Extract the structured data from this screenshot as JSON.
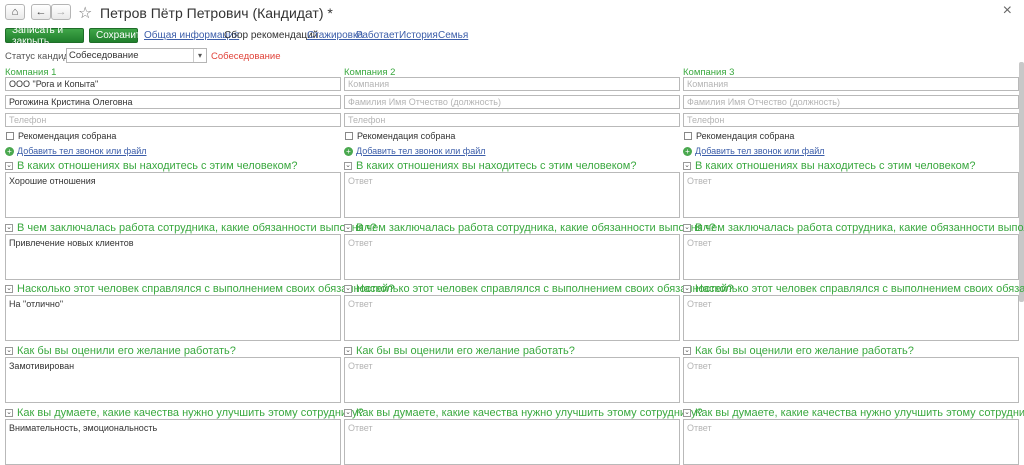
{
  "window": {
    "title": "Петров Пётр Петрович (Кандидат) *",
    "home_icon": "home-icon",
    "back_icon": "arrow-left-icon",
    "forward_icon": "arrow-right-icon",
    "favorite_icon": "star-icon",
    "close_icon": "close-icon"
  },
  "toolbar": {
    "save_close_label": "Записать и закрыть",
    "save_label": "Сохранить",
    "tabs": [
      {
        "label": "Общая информация",
        "active": false
      },
      {
        "label": "Сбор рекомендаций",
        "active": true
      },
      {
        "label": "Стажировка",
        "active": false
      },
      {
        "label": "Работает",
        "active": false
      },
      {
        "label": "История",
        "active": false
      },
      {
        "label": "Семья",
        "active": false
      }
    ]
  },
  "status": {
    "label": "Статус кандидата:",
    "value": "Собеседование",
    "note": "Собеседование"
  },
  "companies": [
    {
      "title": "Компания 1",
      "company_value": "ООО \"Рога и Копыта\"",
      "company_placeholder": "Компания",
      "person_value": "Рогожина Кристина Олеговна",
      "person_placeholder": "Фамилия Имя Отчество (должность)",
      "phone_value": "",
      "phone_placeholder": "Телефон",
      "recommendation_label": "Рекомендация собрана",
      "add_link_label": "Добавить тел звонок или файл",
      "answers": [
        "Хорошие отношения",
        "Привлечение новых клиентов",
        "На \"отлично\"",
        "Замотивирован",
        "Внимательность, эмоциональность"
      ]
    },
    {
      "title": "Компания 2",
      "company_value": "",
      "company_placeholder": "Компания",
      "person_value": "",
      "person_placeholder": "Фамилия Имя Отчество (должность)",
      "phone_value": "",
      "phone_placeholder": "Телефон",
      "recommendation_label": "Рекомендация собрана",
      "add_link_label": "Добавить тел звонок или файл",
      "answers": [
        "",
        "",
        "",
        "",
        ""
      ]
    },
    {
      "title": "Компания 3",
      "company_value": "",
      "company_placeholder": "Компания",
      "person_value": "",
      "person_placeholder": "Фамилия Имя Отчество (должность)",
      "phone_value": "",
      "phone_placeholder": "Телефон",
      "recommendation_label": "Рекомендация собрана",
      "add_link_label": "Добавить тел звонок или файл",
      "answers": [
        "",
        "",
        "",
        "",
        ""
      ]
    }
  ],
  "questions": [
    "В каких отношениях вы находитесь с этим человеком?",
    "В чем заключалась работа сотрудника, какие обязанности выполнял?",
    "Насколько этот человек справлялся с выполнением своих обязанностей?",
    "Как бы вы оценили его желание работать?",
    "Как вы думаете, какие качества нужно улучшить этому сотруднику?"
  ],
  "answer_placeholder": "Ответ",
  "colors": {
    "accent_green": "#3aa83f",
    "link_blue": "#3b5da9",
    "status_red": "#e0433a"
  }
}
